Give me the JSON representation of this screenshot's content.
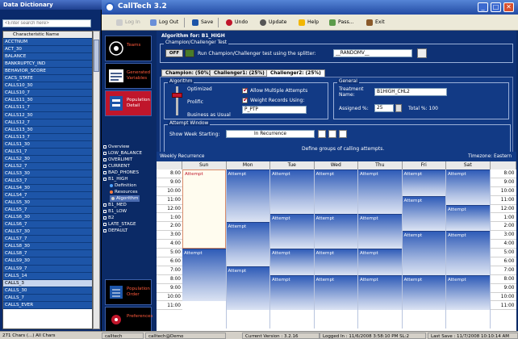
{
  "data_dictionary": {
    "title": "Data Dictionary",
    "search_placeholder": "<Enter search here>",
    "column_header": "Characteristic Name",
    "items": [
      "ACCTNUM",
      "ACT_30",
      "BALANCE",
      "BANKRUPTCY_IND",
      "BEHAVIOR_SCORE",
      "CACS_STATE",
      "CALLS10_30",
      "CALLS10_7",
      "CALLS11_30",
      "CALLS11_7",
      "CALLS12_30",
      "CALLS12_7",
      "CALLS13_30",
      "CALLS13_7",
      "CALLS1_30",
      "CALLS1_7",
      "CALLS2_30",
      "CALLS2_7",
      "CALLS3_30",
      "CALLS3_7",
      "CALLS4_30",
      "CALLS4_7",
      "CALLS5_30",
      "CALLS5_7",
      "CALLS6_30",
      "CALLS6_7",
      "CALLS7_30",
      "CALLS7_7",
      "CALLS8_30",
      "CALLS8_7",
      "CALLS9_30",
      "CALLS9_7",
      "CALLS_14",
      "CALLS_3",
      "CALLS_30",
      "CALLS_7",
      "CALLS_EVER"
    ],
    "selected_item": "CALLS_3",
    "status": "271 Chars (...)   All Chars"
  },
  "app": {
    "title": "CallTech 3.2",
    "window_buttons": {
      "minimize": "_",
      "maximize": "□",
      "close": "✕"
    },
    "toolbar": {
      "login": "Log In",
      "logout": "Log Out",
      "save": "Save",
      "undo": "Undo",
      "update": "Update",
      "help": "Help",
      "pass": "Pass...",
      "exit": "Exit"
    },
    "nav_tiles": [
      {
        "label": "Teams"
      },
      {
        "label": "Generated\nVariables"
      },
      {
        "label": "Population\nDetail"
      },
      {
        "label": "Population\nOrder"
      },
      {
        "label": "Preferences"
      }
    ],
    "tree": {
      "overview": "Overview",
      "low_balance": "LOW_BALANCE",
      "overlimit": "OVERLIMIT",
      "current": "CURRENT",
      "bad_phones": "BAD_PHONES",
      "b1_high": "B1_HIGH",
      "definition": "Definition",
      "resources": "Resources",
      "algorithm": "Algorithm",
      "b1_med": "B1_MED",
      "b1_low": "B1_LOW",
      "b2": "B2",
      "late_stage": "LATE_STAGE",
      "default": "DEFAULT"
    },
    "colors": {
      "accent": "#c0162b",
      "nav_bg": "#0b2a66",
      "panel_bg": "#0e3175",
      "attempt": "#3a5fb8"
    }
  },
  "main": {
    "heading": "Algorithm for: B1_HIGH",
    "champion_test": {
      "legend": "Champion/Challenger Test",
      "toggle_label": "OFF",
      "run_text": "Run Champion/Challenger test using the splitter:",
      "splitter_value": "__RANDOMV__"
    },
    "tabs": [
      "Champion: (50%)",
      "Challenger1: (25%)",
      "Challenger2: (25%)"
    ],
    "active_tab": 2,
    "algorithm": {
      "legend": "Algorithm",
      "optimized": "Optimized",
      "prolific": "Prolific",
      "business_as_usual": "Business as Usual",
      "allow_multiple": "Allow Multiple Attempts",
      "weight_records": "Weight Records Using:",
      "weight_value": "P_PTP"
    },
    "general": {
      "legend": "General",
      "treatment_label": "Treatment\nName:",
      "treatment_value": "B1HIGH_CHL2",
      "assigned_label": "Assigned %:",
      "assigned_value": "25",
      "total_text": "Total %: 100"
    },
    "attempt_window": {
      "legend": "Attempt Window",
      "show_week_label": "Show Week Starting:",
      "recurrence_value": "In Recurrence",
      "define_text": "Define groups of calling attempts.",
      "weekly_label": "Weekly Recurrence",
      "timezone": "Timezone: Eastern",
      "days": [
        "Sun",
        "Mon",
        "Tue",
        "Wed",
        "Thu",
        "Fri",
        "Sat"
      ],
      "hours": [
        "8:00",
        "9:00",
        "10:00",
        "11:00",
        "12:00",
        "1:00",
        "2:00",
        "3:00",
        "4:00",
        "5:00",
        "6:00",
        "7:00",
        "8:00",
        "9:00",
        "10:00",
        "11:00"
      ],
      "attempt_label": "Attempt"
    }
  },
  "statusbar": {
    "user": "calltech",
    "login": "calltech@Demo",
    "version": "Current Version : 3.2.16",
    "logged_in": "Logged In : 11/6/2008 3:58:10 PM  SL:2",
    "last_save": "Last Save : 11/7/2008 10:10:14 AM"
  }
}
